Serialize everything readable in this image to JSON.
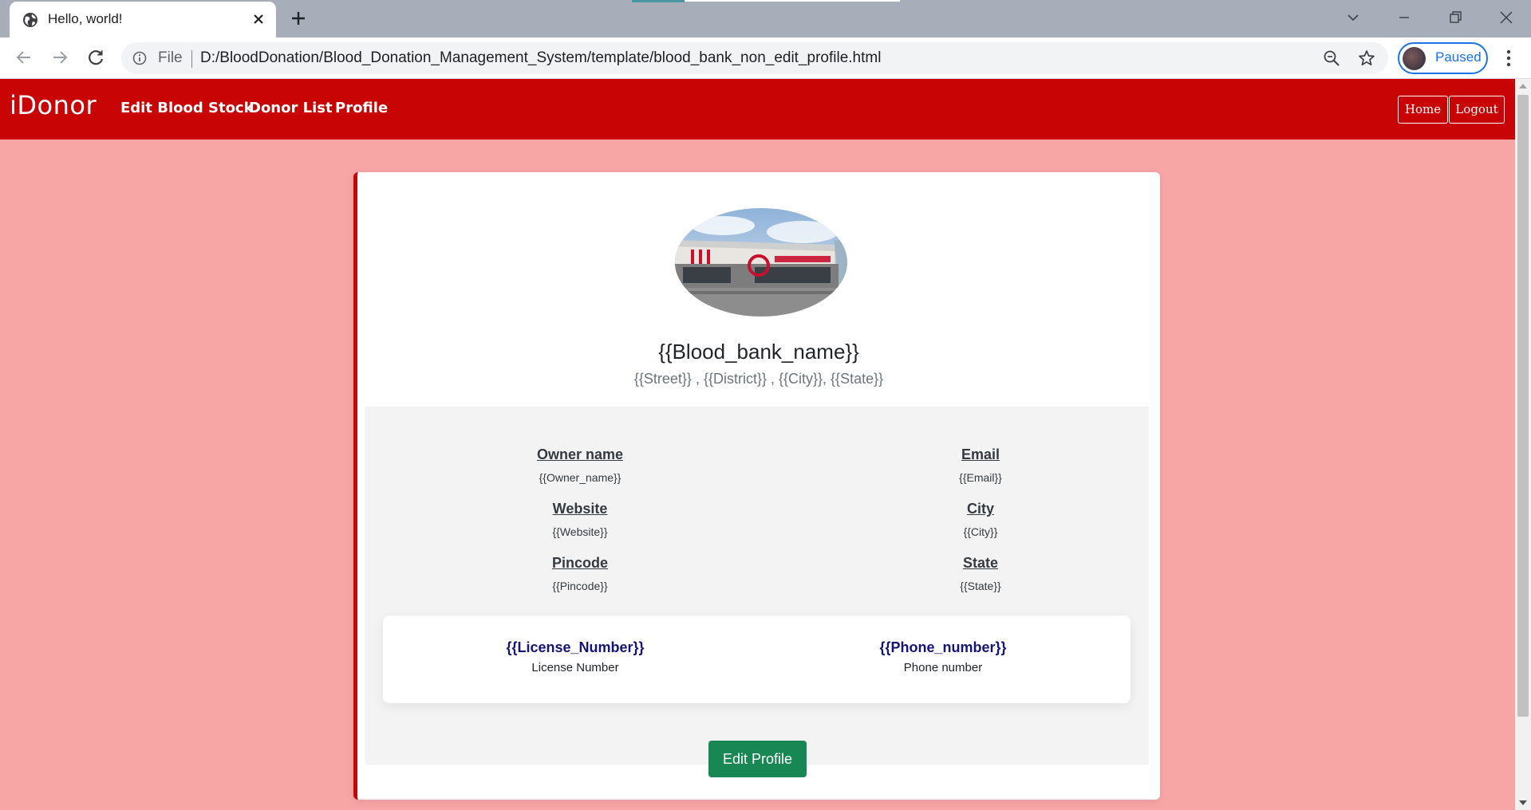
{
  "browser": {
    "tab_title": "Hello, world!",
    "file_label": "File",
    "url": "D:/BloodDonation/Blood_Donation_Management_System/template/blood_bank_non_edit_profile.html",
    "profile_status": "Paused",
    "icons": [
      "globe-icon",
      "close-icon",
      "plus-icon",
      "chevron-down-icon",
      "minimize-icon",
      "restore-icon",
      "back-icon",
      "forward-icon",
      "reload-icon",
      "info-icon",
      "zoom-icon",
      "star-icon",
      "kebab-icon"
    ]
  },
  "nav": {
    "brand": "iDonor",
    "links": [
      "Edit Blood Stock",
      "Donor List",
      "Profile"
    ],
    "home_label": "Home",
    "logout_label": "Logout",
    "bar_color": "#c80404"
  },
  "profile": {
    "bank_name": "{{Blood_bank_name}}",
    "address": "{{Street}} , {{District}} , {{City}}, {{State}}",
    "fields": {
      "owner_name": {
        "label": "Owner name",
        "value": "{{Owner_name}}"
      },
      "email": {
        "label": "Email",
        "value": "{{Email}}"
      },
      "website": {
        "label": "Website",
        "value": "{{Website}}"
      },
      "city": {
        "label": "City",
        "value": "{{City}}"
      },
      "pincode": {
        "label": "Pincode",
        "value": "{{Pincode}}"
      },
      "state": {
        "label": "State",
        "value": "{{State}}"
      }
    },
    "license": {
      "value": "{{License_Number}}",
      "label": "License Number"
    },
    "phone": {
      "value": "{{Phone_number}}",
      "label": "Phone number"
    },
    "edit_label": "Edit Profile"
  },
  "colors": {
    "page_background": "#f8a5a6",
    "accent": "#c80404",
    "button_green": "#198754",
    "stat_text": "#151577"
  }
}
